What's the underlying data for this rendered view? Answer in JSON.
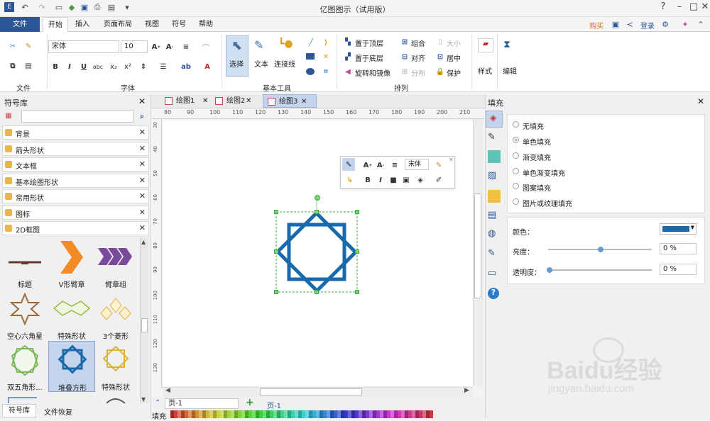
{
  "title": "亿图图示（试用版）",
  "ribbon_tabs": [
    "文件",
    "开始",
    "插入",
    "页面布局",
    "视图",
    "符号",
    "帮助"
  ],
  "top_right": {
    "buy": "购买",
    "login": "登录"
  },
  "font": {
    "name": "宋体",
    "size": "10"
  },
  "tools": {
    "select": "选择",
    "text": "文本",
    "connector": "连接线"
  },
  "arrange": {
    "bring_front": "置于顶层",
    "send_back": "置于底层",
    "rotate_mirror": "旋转和镜像",
    "group": "组合",
    "align": "对齐",
    "distribute": "分布",
    "size": "大小",
    "center": "居中",
    "protect": "保护"
  },
  "style_btn": "样式",
  "edit_btn": "编辑",
  "groups": {
    "file": "文件",
    "font": "字体",
    "basic_tools": "基本工具",
    "arrange": "排列"
  },
  "library": {
    "title": "符号库",
    "categories": [
      "背景",
      "箭头形状",
      "文本框",
      "基本绘图形状",
      "常用形状",
      "图标",
      "2D框图"
    ],
    "shapes": [
      "标题",
      "V形臂章",
      "臂章组",
      "空心六角星",
      "特殊形状",
      "3个菱形",
      "双五角形...",
      "堆叠方形",
      "特殊形状"
    ],
    "bottom_tabs": [
      "符号库",
      "文件恢复"
    ]
  },
  "doc_tabs": [
    "绘图1",
    "绘图2",
    "绘图3"
  ],
  "ruler_h": [
    "80",
    "90",
    "100",
    "110",
    "120",
    "130",
    "140",
    "150",
    "160",
    "170",
    "180",
    "190",
    "200",
    "210"
  ],
  "ruler_v": [
    "30",
    "40",
    "50",
    "60",
    "70",
    "80",
    "90",
    "100",
    "110",
    "120",
    "130"
  ],
  "float_toolbar": {
    "font": "宋体"
  },
  "fill_panel": {
    "title": "填充",
    "options": [
      "无填充",
      "单色填充",
      "渐变填充",
      "单色渐变填充",
      "图案填充",
      "图片或纹理填充"
    ],
    "selected_option": "单色填充",
    "color_label": "颜色：",
    "brightness_label": "亮度：",
    "brightness_value": "0 %",
    "transparency_label": "透明度：",
    "transparency_value": "0 %",
    "fill_color": "#1a6aab"
  },
  "status": {
    "page_selector": "页-1",
    "page_tab": "页-1",
    "fill_label": "填充"
  },
  "watermark": {
    "brand": "Baidu经验",
    "url": "jingyan.baidu.com"
  }
}
